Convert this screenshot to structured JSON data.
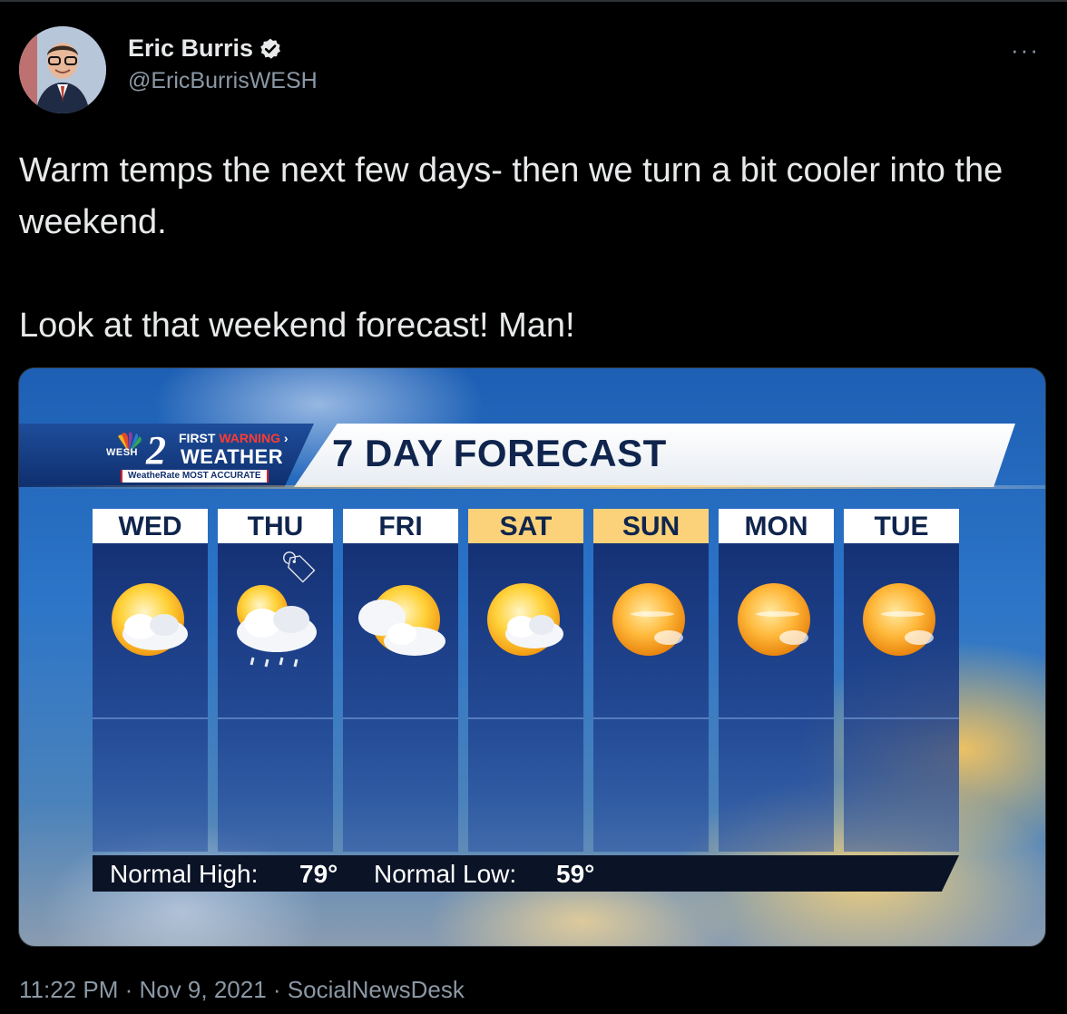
{
  "tweet": {
    "author_name": "Eric Burris",
    "author_handle": "@EricBurrisWESH",
    "verified": true,
    "more_icon": "more-horizontal-icon",
    "text_line1": "Warm temps the next few days- then we turn a bit cooler into the weekend.",
    "text_line2": "Look at that weekend forecast! Man!",
    "timestamp": "11:22 PM · Nov 9, 2021 · SocialNewsDesk"
  },
  "media": {
    "station": "WESH",
    "channel_number": "2",
    "brand_first": "FIRST",
    "brand_warning": "WARNING",
    "brand_weather": "WEATHER",
    "brand_rating": "WeatheRate MOST ACCURATE",
    "title": "7 DAY FORECAST",
    "days": [
      {
        "label": "WED",
        "icon": "partly-cloudy-icon",
        "highlight": false
      },
      {
        "label": "THU",
        "icon": "cloudy-showers-icon",
        "highlight": false
      },
      {
        "label": "FRI",
        "icon": "partly-cloudy-icon",
        "highlight": false
      },
      {
        "label": "SAT",
        "icon": "partly-cloudy-icon",
        "highlight": true
      },
      {
        "label": "SUN",
        "icon": "sunny-icon",
        "highlight": true
      },
      {
        "label": "MON",
        "icon": "sunny-icon",
        "highlight": false
      },
      {
        "label": "TUE",
        "icon": "sunny-icon",
        "highlight": false
      }
    ],
    "normal_high_label": "Normal High:",
    "normal_high_value": "79°",
    "normal_low_label": "Normal Low:",
    "normal_low_value": "59°"
  },
  "colors": {
    "background": "#000000",
    "text": "#e7e9ea",
    "muted": "#8b98a5",
    "verified": "#e7e9ea",
    "weekend_tab": "#fbd27a",
    "forecast_title": "#10254d"
  }
}
